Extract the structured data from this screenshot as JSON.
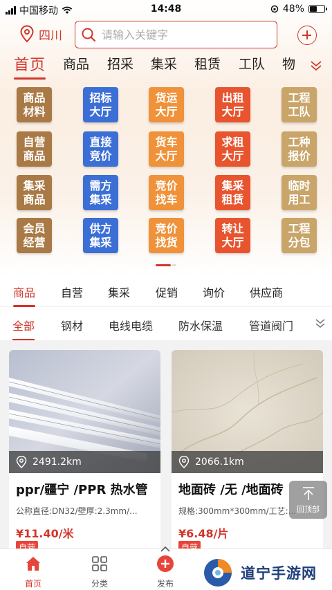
{
  "status_bar": {
    "carrier": "中国移动",
    "time": "14:48",
    "battery": "48%"
  },
  "header": {
    "location": "四川",
    "search_placeholder": "请输入关键字"
  },
  "main_tabs": [
    "首页",
    "商品",
    "招采",
    "集采",
    "租赁",
    "工队",
    "物"
  ],
  "grid": [
    {
      "lines": [
        "商品",
        "材料"
      ],
      "color": "#a97a46"
    },
    {
      "lines": [
        "招标",
        "大厅"
      ],
      "color": "#3c6fd6"
    },
    {
      "lines": [
        "货运",
        "大厅"
      ],
      "color": "#f0923a"
    },
    {
      "lines": [
        "出租",
        "大厅"
      ],
      "color": "#e8542e"
    },
    {
      "lines": [
        "工程",
        "工队"
      ],
      "color": "#c9a56a"
    },
    {
      "lines": [
        "自营",
        "商品"
      ],
      "color": "#a97a46"
    },
    {
      "lines": [
        "直接",
        "竞价"
      ],
      "color": "#3c6fd6"
    },
    {
      "lines": [
        "货车",
        "大厅"
      ],
      "color": "#f0923a"
    },
    {
      "lines": [
        "求租",
        "大厅"
      ],
      "color": "#e8542e"
    },
    {
      "lines": [
        "工种",
        "报价"
      ],
      "color": "#c9a56a"
    },
    {
      "lines": [
        "集采",
        "商品"
      ],
      "color": "#a97a46"
    },
    {
      "lines": [
        "需方",
        "集采"
      ],
      "color": "#3c6fd6"
    },
    {
      "lines": [
        "竞价",
        "找车"
      ],
      "color": "#f0923a"
    },
    {
      "lines": [
        "集采",
        "租赁"
      ],
      "color": "#e8542e"
    },
    {
      "lines": [
        "临时",
        "用工"
      ],
      "color": "#c9a56a"
    },
    {
      "lines": [
        "会员",
        "经营"
      ],
      "color": "#a97a46"
    },
    {
      "lines": [
        "供方",
        "集采"
      ],
      "color": "#3c6fd6"
    },
    {
      "lines": [
        "竞价",
        "找货"
      ],
      "color": "#f0923a"
    },
    {
      "lines": [
        "转让",
        "大厅"
      ],
      "color": "#e8542e"
    },
    {
      "lines": [
        "工程",
        "分包"
      ],
      "color": "#c9a56a"
    }
  ],
  "category_tabs": [
    "商品",
    "自营",
    "集采",
    "促销",
    "询价",
    "供应商"
  ],
  "sub_tabs": [
    "全部",
    "钢材",
    "电线电缆",
    "防水保温",
    "管道阀门"
  ],
  "products": [
    {
      "distance": "2491.2km",
      "title": "ppr/疆宁 /PPR 热水管",
      "spec": "公称直径:DN32/壁厚:2.3mm/...",
      "price": "¥11.40/米",
      "badge": "自营"
    },
    {
      "distance": "2066.1km",
      "title": "地面砖 /无 /地面砖",
      "spec": "规格:300mm*300mm/工艺:...",
      "price": "¥6.48/片",
      "badge": "自营"
    }
  ],
  "back_top": "回顶部",
  "bottom_nav": [
    "首页",
    "分类",
    "发布"
  ],
  "watermark": "道宁手游网",
  "colors": {
    "accent": "#d2352b"
  }
}
